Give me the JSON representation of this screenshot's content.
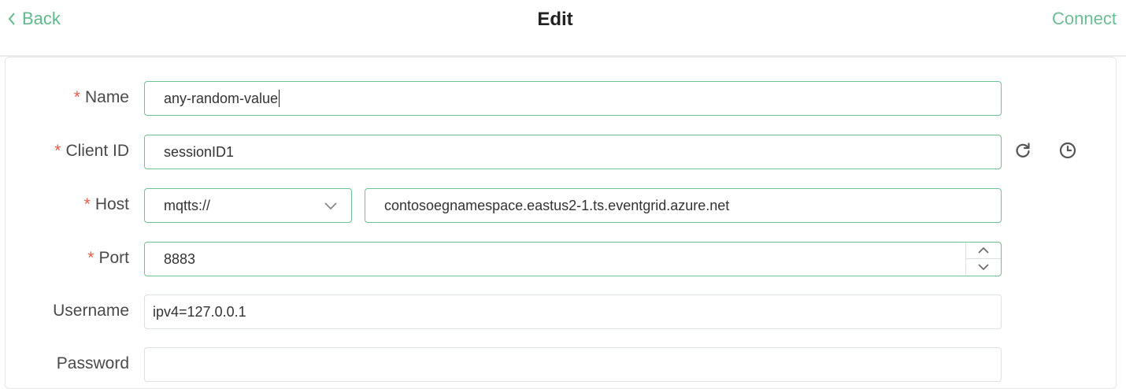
{
  "header": {
    "back_label": "Back",
    "title": "Edit",
    "connect_label": "Connect"
  },
  "form": {
    "name": {
      "label": "Name",
      "value": "any-random-value",
      "required": "*"
    },
    "client_id": {
      "label": "Client ID",
      "value": "sessionID1",
      "required": "*"
    },
    "host": {
      "label": "Host",
      "protocol": "mqtts://",
      "value": "contosoegnamespace.eastus2-1.ts.eventgrid.azure.net",
      "required": "*"
    },
    "port": {
      "label": "Port",
      "value": "8883",
      "required": "*"
    },
    "username": {
      "label": "Username",
      "value": "ipv4=127.0.0.1"
    },
    "password": {
      "label": "Password",
      "value": ""
    }
  },
  "icons": {
    "refresh": "refresh-icon",
    "history": "clock-icon",
    "back": "chevron-left-icon",
    "dropdown": "chevron-down-icon"
  },
  "colors": {
    "accent": "#34c388",
    "required": "#e8594a"
  }
}
